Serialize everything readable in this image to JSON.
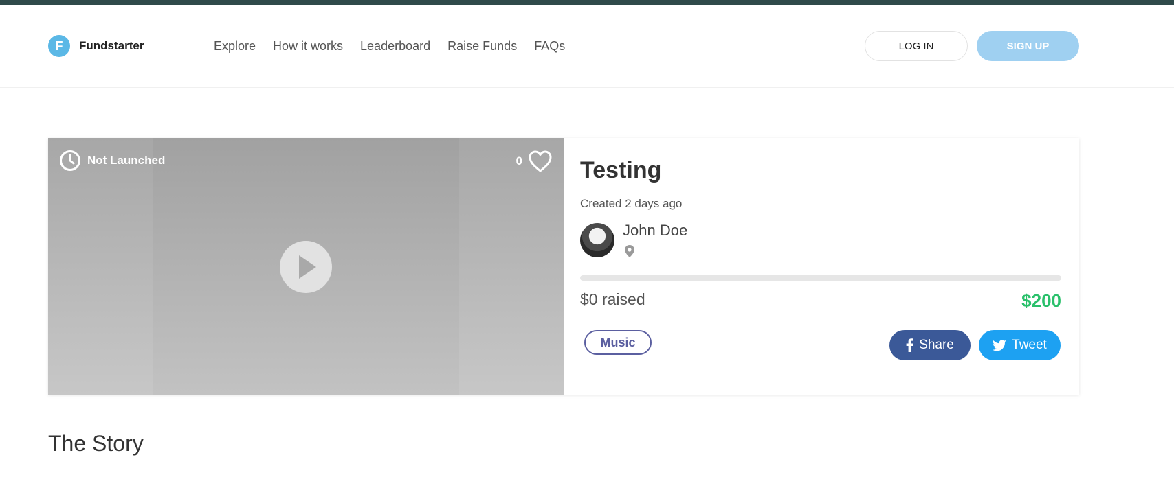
{
  "brand": {
    "logo_letter": "F",
    "name": "Fundstarter"
  },
  "nav": {
    "items": [
      "Explore",
      "How it works",
      "Leaderboard",
      "Raise Funds",
      "FAQs"
    ]
  },
  "auth": {
    "login_label": "LOG IN",
    "signup_label": "SIGN UP"
  },
  "campaign": {
    "status": "Not Launched",
    "likes": "0",
    "title": "Testing",
    "created": "Created 2 days ago",
    "author": "John Doe",
    "raised": "$0 raised",
    "goal": "$200",
    "progress_fraction": 0,
    "tag": "Music",
    "share_label": "Share",
    "tweet_label": "Tweet",
    "icons": [
      "clock-icon",
      "heart-icon",
      "play-icon",
      "location-pin-icon",
      "facebook-icon",
      "twitter-icon"
    ]
  },
  "story": {
    "title": "The Story"
  },
  "colors": {
    "header_strip": "#2f4a4a",
    "brand": "#5bb8e6",
    "signup": "#9fd0f1",
    "goal": "#2ac06b",
    "tag": "#5b5fa0",
    "facebook": "#3b5998",
    "twitter": "#1da1f2"
  }
}
